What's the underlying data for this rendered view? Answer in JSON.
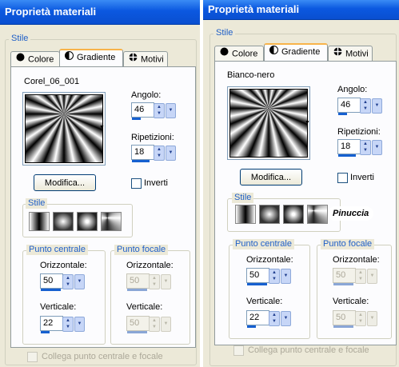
{
  "left": {
    "title": "Proprietà materiali",
    "group_stile": "Stile",
    "tabs": [
      "Colore",
      "Gradiente",
      "Motivi"
    ],
    "gradient_name": "Corel_06_001",
    "angolo_label": "Angolo:",
    "angolo_value": "46",
    "ripetizioni_label": "Ripetizioni:",
    "ripetizioni_value": "18",
    "modifica_label": "Modifica...",
    "inverti_label": "Inverti",
    "style_group": "Stile",
    "punto_centrale": "Punto centrale",
    "punto_focale": "Punto focale",
    "orizzontale_label": "Orizzontale:",
    "verticale_label": "Verticale:",
    "centrale_orizz_value": "50",
    "centrale_vert_value": "22",
    "focale_orizz_value": "50",
    "focale_vert_value": "50",
    "collega_label": "Collega punto centrale e focale"
  },
  "right": {
    "title": "Proprietà materiali",
    "group_stile": "Stile",
    "tabs": [
      "Colore",
      "Gradiente",
      "Motivi"
    ],
    "gradient_name": "Bianco-nero",
    "angolo_label": "Angolo:",
    "angolo_value": "46",
    "ripetizioni_label": "Ripetizioni:",
    "ripetizioni_value": "18",
    "modifica_label": "Modifica...",
    "inverti_label": "Inverti",
    "style_group": "Stile",
    "logo_text": "Pinuccia",
    "punto_centrale": "Punto centrale",
    "punto_focale": "Punto focale",
    "orizzontale_label": "Orizzontale:",
    "verticale_label": "Verticale:",
    "centrale_orizz_value": "50",
    "centrale_vert_value": "22",
    "focale_orizz_value": "50",
    "focale_vert_value": "50",
    "collega_label": "Collega punto centrale e focale"
  },
  "colors": {
    "titlebar": "#0b58e0",
    "group_title": "#1f5fc7",
    "panel_bg": "#ece9d8",
    "active_tab_accent": "#f8b34a"
  }
}
